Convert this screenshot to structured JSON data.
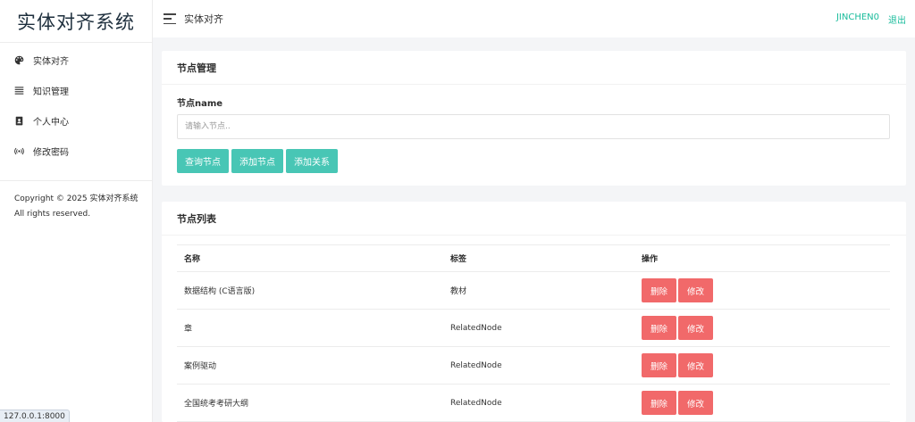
{
  "brand": "实体对齐系统",
  "sidebar": {
    "items": [
      {
        "label": "实体对齐",
        "icon": "palette-icon"
      },
      {
        "label": "知识管理",
        "icon": "list-icon"
      },
      {
        "label": "个人中心",
        "icon": "address-book-icon"
      },
      {
        "label": "修改密码",
        "icon": "broadcast-icon"
      }
    ],
    "copyright": "Copyright © 2025 实体对齐系统 All rights reserved."
  },
  "header": {
    "title": "实体对齐",
    "user": "JINCHEN0",
    "logout": "退出"
  },
  "node_manage": {
    "title": "节点管理",
    "field_label": "节点name",
    "placeholder": "请输入节点..",
    "buttons": {
      "query": "查询节点",
      "add_node": "添加节点",
      "add_relation": "添加关系"
    }
  },
  "node_list": {
    "title": "节点列表",
    "columns": [
      "名称",
      "标签",
      "操作"
    ],
    "delete_label": "删除",
    "edit_label": "修改",
    "rows": [
      {
        "name": "数据结构 (C语言版)",
        "label": "教材"
      },
      {
        "name": "章",
        "label": "RelatedNode"
      },
      {
        "name": "案例驱动",
        "label": "RelatedNode"
      },
      {
        "name": "全国统考考研大纲",
        "label": "RelatedNode"
      }
    ]
  },
  "status_bar": {
    "url": "127.0.0.1:8000"
  },
  "colors": {
    "accent": "#48c6b5",
    "danger": "#f1696a",
    "link": "#1abc9c"
  }
}
